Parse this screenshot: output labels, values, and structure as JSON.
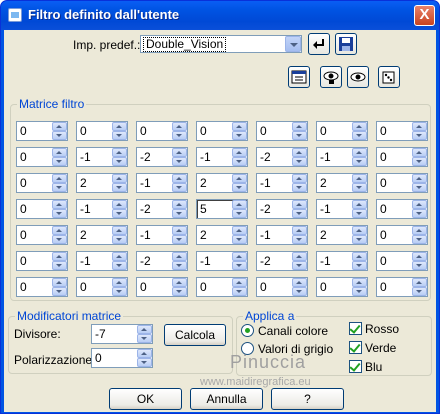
{
  "window": {
    "title": "Filtro definito dall'utente",
    "close_label": "X"
  },
  "preset": {
    "label": "Imp. predef.:",
    "value": "Double_Vision"
  },
  "matrix": {
    "legend": "Matrice filtro",
    "rows": [
      [
        "0",
        "0",
        "0",
        "0",
        "0",
        "0",
        "0"
      ],
      [
        "0",
        "-1",
        "-2",
        "-1",
        "-2",
        "-1",
        "0"
      ],
      [
        "0",
        "2",
        "-1",
        "2",
        "-1",
        "2",
        "0"
      ],
      [
        "0",
        "-1",
        "-2",
        "5",
        "-2",
        "-1",
        "0"
      ],
      [
        "0",
        "2",
        "-1",
        "2",
        "-1",
        "2",
        "0"
      ],
      [
        "0",
        "-1",
        "-2",
        "-1",
        "-2",
        "-1",
        "0"
      ],
      [
        "0",
        "0",
        "0",
        "0",
        "0",
        "0",
        "0"
      ]
    ]
  },
  "modifiers": {
    "legend": "Modificatori matrice",
    "divisor_label": "Divisore:",
    "divisor_value": "-7",
    "bias_label": "Polarizzazione:",
    "bias_value": "0",
    "calc_label": "Calcola"
  },
  "apply": {
    "legend": "Applica a",
    "color_channels": "Canali colore",
    "gray_values": "Valori di grigio",
    "red": "Rosso",
    "green": "Verde",
    "blue": "Blu"
  },
  "watermark": {
    "name": "Pinuccia",
    "url": "www.maidiregrafica.eu"
  },
  "buttons": {
    "ok": "OK",
    "cancel": "Annulla",
    "help": "?"
  }
}
